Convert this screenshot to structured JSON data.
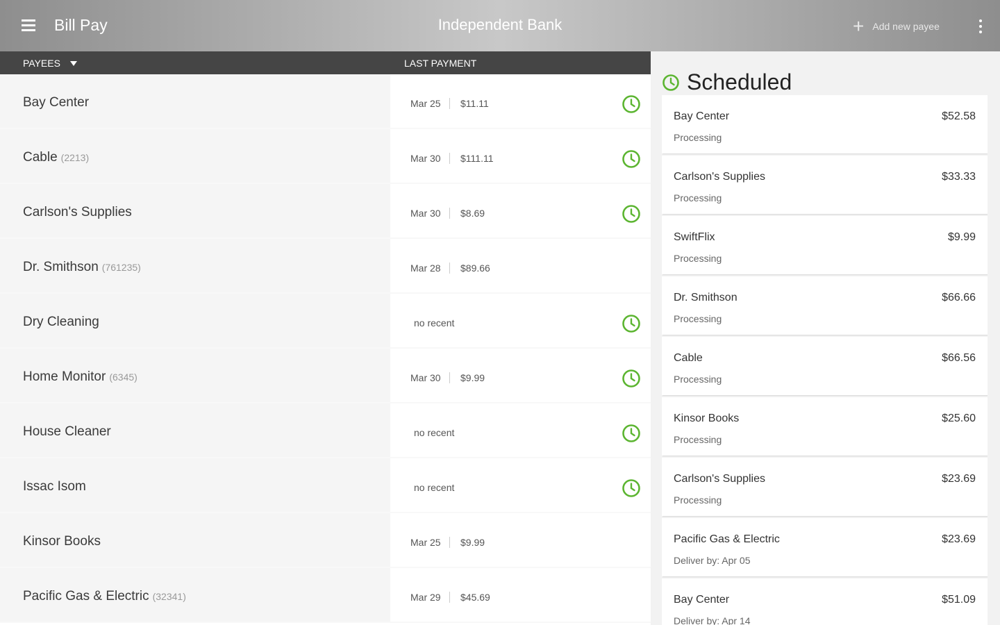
{
  "appbar": {
    "title": "Bill Pay",
    "bank_name": "Independent Bank",
    "add_payee_label": "Add new payee"
  },
  "list_header": {
    "payees_label": "PAYEES",
    "last_payment_label": "LAST PAYMENT"
  },
  "payees": [
    {
      "name": "Bay Center",
      "account": "",
      "date": "Mar 25",
      "amount": "$11.11",
      "no_recent": "",
      "scheduled": true
    },
    {
      "name": "Cable",
      "account": "(2213)",
      "date": "Mar 30",
      "amount": "$111.11",
      "no_recent": "",
      "scheduled": true
    },
    {
      "name": "Carlson's Supplies",
      "account": "",
      "date": "Mar 30",
      "amount": "$8.69",
      "no_recent": "",
      "scheduled": true
    },
    {
      "name": "Dr. Smithson",
      "account": "(761235)",
      "date": "Mar 28",
      "amount": "$89.66",
      "no_recent": "",
      "scheduled": false
    },
    {
      "name": "Dry Cleaning",
      "account": "",
      "date": "",
      "amount": "",
      "no_recent": "no recent",
      "scheduled": true
    },
    {
      "name": "Home Monitor",
      "account": "(6345)",
      "date": "Mar 30",
      "amount": "$9.99",
      "no_recent": "",
      "scheduled": true
    },
    {
      "name": "House Cleaner",
      "account": "",
      "date": "",
      "amount": "",
      "no_recent": "no recent",
      "scheduled": true
    },
    {
      "name": "Issac Isom",
      "account": "",
      "date": "",
      "amount": "",
      "no_recent": "no recent",
      "scheduled": true
    },
    {
      "name": "Kinsor Books",
      "account": "",
      "date": "Mar 25",
      "amount": "$9.99",
      "no_recent": "",
      "scheduled": false
    },
    {
      "name": "Pacific Gas & Electric",
      "account": "(32341)",
      "date": "Mar 29",
      "amount": "$45.69",
      "no_recent": "",
      "scheduled": false
    }
  ],
  "scheduled": {
    "title": "Scheduled",
    "items": [
      {
        "name": "Bay Center",
        "amount": "$52.58",
        "status": "Processing"
      },
      {
        "name": "Carlson's Supplies",
        "amount": "$33.33",
        "status": "Processing"
      },
      {
        "name": "SwiftFlix",
        "amount": "$9.99",
        "status": "Processing"
      },
      {
        "name": "Dr. Smithson",
        "amount": "$66.66",
        "status": "Processing"
      },
      {
        "name": "Cable",
        "amount": "$66.56",
        "status": "Processing"
      },
      {
        "name": "Kinsor Books",
        "amount": "$25.60",
        "status": "Processing"
      },
      {
        "name": "Carlson's Supplies",
        "amount": "$23.69",
        "status": "Processing"
      },
      {
        "name": "Pacific Gas & Electric",
        "amount": "$23.69",
        "status": "Deliver by: Apr 05"
      },
      {
        "name": "Bay Center",
        "amount": "$51.09",
        "status": "Deliver by: Apr 14"
      }
    ]
  },
  "colors": {
    "accent_green": "#5cb531",
    "header_dark": "#454545"
  },
  "icons": {
    "menu": "menu-icon",
    "add": "plus-icon",
    "overflow": "more-vert-icon",
    "scheduled": "clock-icon",
    "sort": "caret-down-icon"
  }
}
